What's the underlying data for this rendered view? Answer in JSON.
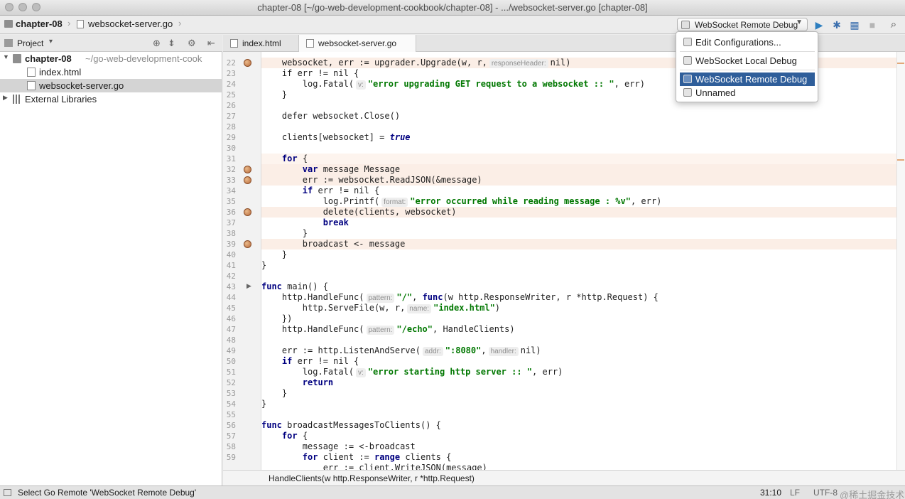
{
  "window": {
    "title": "chapter-08 [~/go-web-development-cookbook/chapter-08] - .../websocket-server.go [chapter-08]"
  },
  "navbar": {
    "crumb_project": "chapter-08",
    "crumb_file": "websocket-server.go",
    "run_config_selected": "WebSocket Remote Debug",
    "run_icon": "run-icon",
    "debug_icon": "debug-icon",
    "coverage_icon": "coverage-icon",
    "stop_icon": "stop-icon",
    "search_icon": "search-icon"
  },
  "project_panel": {
    "header_label": "Project",
    "tree": [
      {
        "name": "chapter-08",
        "hint": "~/go-web-development-cook"
      },
      {
        "name": "index.html"
      },
      {
        "name": "websocket-server.go"
      },
      {
        "name": "External Libraries"
      }
    ]
  },
  "tabs": [
    {
      "label": "index.html"
    },
    {
      "label": "websocket-server.go"
    }
  ],
  "run_config_popup": {
    "items": [
      {
        "label": "Edit Configurations..."
      },
      {
        "label": "WebSocket Local Debug"
      },
      {
        "label": "WebSocket Remote Debug"
      },
      {
        "label": "Unnamed"
      }
    ]
  },
  "editor": {
    "line_numbers": [
      "22",
      "23",
      "24",
      "25",
      "26",
      "27",
      "28",
      "29",
      "30",
      "31",
      "32",
      "33",
      "34",
      "35",
      "36",
      "37",
      "38",
      "39",
      "40",
      "41",
      "42",
      "43",
      "44",
      "45",
      "46",
      "47",
      "48",
      "49",
      "50",
      "51",
      "52",
      "53",
      "54",
      "55",
      "56",
      "57",
      "58",
      "59"
    ],
    "breakpoint_lines": [
      "22",
      "32",
      "33",
      "36",
      "39"
    ],
    "hints": {
      "responseHeader": "responseHeader:",
      "v1": "v:",
      "format": "format:",
      "pattern1": "pattern:",
      "name": "name:",
      "pattern2": "pattern:",
      "addr": "addr:",
      "handler": "handler:",
      "v2": "v:"
    },
    "code": {
      "l22a": "websocket, err := upgrader.Upgrade(w, r,",
      "l22b": "nil)",
      "l23": "    if err != nil {",
      "l24a": "        log.Fatal(",
      "l24b": "\"error upgrading GET request to a websocket :: \"",
      "l24c": ", err)",
      "l25": "    }",
      "l27": "    defer websocket.Close()",
      "l29a": "    clients[websocket] = ",
      "l29b": "true",
      "l31a": "    ",
      "l31b": "for",
      "l31c": " {",
      "l32a": "        ",
      "l32b": "var",
      "l32c": " message Message",
      "l33": "        err := websocket.ReadJSON(&message)",
      "l34a": "        ",
      "l34b": "if",
      "l34c": " err != nil {",
      "l35a": "            log.Printf(",
      "l35b": "\"error occurred while reading message : %v\"",
      "l35c": ", err)",
      "l36": "            delete(clients, websocket)",
      "l37a": "            ",
      "l37b": "break",
      "l38": "        }",
      "l39": "        broadcast <- message",
      "l40": "    }",
      "l41": "}",
      "l43a": "func",
      "l43b": " main() {",
      "l44a": "    http.HandleFunc(",
      "l44b": "\"/\"",
      "l44c": ", ",
      "l44d": "func",
      "l44e": "(w http.ResponseWriter, r *http.Request) {",
      "l45a": "        http.ServeFile(w, r,",
      "l45b": "\"index.html\"",
      "l45c": ")",
      "l46": "    })",
      "l47a": "    http.HandleFunc(",
      "l47b": "\"/echo\"",
      "l47c": ", HandleClients)",
      "l49a": "    err := http.ListenAndServe(",
      "l49b": "\":8080\"",
      "l49c": ",",
      "l49d": "nil)",
      "l50a": "    ",
      "l50b": "if",
      "l50c": " err != nil {",
      "l51a": "        log.Fatal(",
      "l51b": "\"error starting http server :: \"",
      "l51c": ", err)",
      "l52a": "        ",
      "l52b": "return",
      "l53": "    }",
      "l54": "}",
      "l56a": "func",
      "l56b": " broadcastMessagesToClients() {",
      "l57a": "    ",
      "l57b": "for",
      "l57c": " {",
      "l58": "        message := <-broadcast",
      "l59a": "        ",
      "l59b": "for",
      "l59c": " client := ",
      "l59d": "range",
      "l59e": " clients {",
      "l60": "            err := client.WriteJSON(message)"
    }
  },
  "editor_breadcrumb": "HandleClients(w http.ResponseWriter, r *http.Request)",
  "status": {
    "message": "Select Go Remote 'WebSocket Remote Debug'",
    "position": "31:10",
    "line_sep": "LF",
    "encoding": "UTF-8",
    "watermark": "@稀土掘金技术社区"
  }
}
